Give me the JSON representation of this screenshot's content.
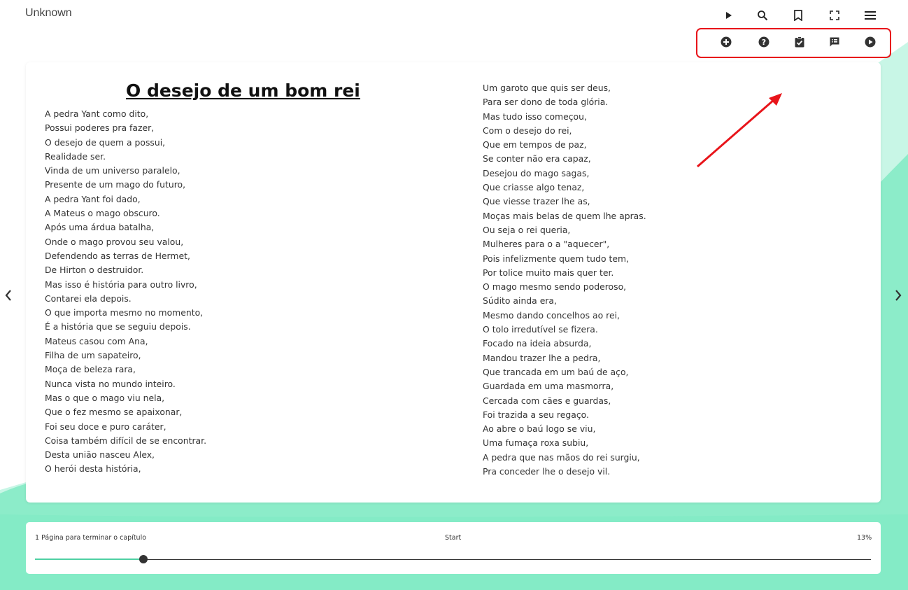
{
  "app": {
    "title": "Unknown"
  },
  "toolbar": {
    "top": [
      "play-icon",
      "search-icon",
      "bookmark-icon",
      "fullscreen-icon",
      "menu-icon"
    ],
    "secondary": [
      "add-circle-icon",
      "help-icon",
      "assignment-check-icon",
      "feedback-icon",
      "play-circle-icon"
    ]
  },
  "poem": {
    "title": "O desejo de um bom rei",
    "left_lines": [
      "A pedra Yant como dito,",
      "Possui poderes pra fazer,",
      "O desejo de quem a possui,",
      "Realidade ser.",
      "Vinda de um universo paralelo,",
      "Presente de um mago do futuro,",
      "A pedra Yant foi dado,",
      "A Mateus o mago obscuro.",
      "Após uma árdua batalha,",
      "Onde o mago provou seu valou,",
      "Defendendo as terras de Hermet,",
      "De Hirton o destruidor.",
      "Mas isso é história para outro livro,",
      "Contarei ela depois.",
      "O que importa mesmo no momento,",
      "É a história que se seguiu depois.",
      "Mateus casou com Ana,",
      "Filha de um sapateiro,",
      "Moça de beleza rara,",
      "Nunca vista no mundo inteiro.",
      "Mas o que o mago viu nela,",
      "Que o fez mesmo se apaixonar,",
      "Foi seu doce e puro caráter,",
      "Coisa também difícil de se encontrar.",
      "Desta união nasceu Alex,",
      "O herói desta história,"
    ],
    "right_lines": [
      "Um garoto que quis ser deus,",
      "Para ser dono de toda glória.",
      "Mas tudo isso começou,",
      "Com o desejo do rei,",
      "Que em tempos de paz,",
      "Se conter não era capaz,",
      "Desejou do mago sagas,",
      "Que criasse algo tenaz,",
      "Que viesse trazer lhe as,",
      "Moças mais belas de quem lhe apras.",
      "Ou seja o rei queria,",
      "Mulheres para o a \"aquecer\",",
      "Pois infelizmente quem tudo tem,",
      "Por tolice muito mais quer ter.",
      "O mago mesmo sendo poderoso,",
      "Súdito ainda era,",
      "Mesmo dando concelhos ao rei,",
      "O tolo irredutível se fizera.",
      "Focado na ideia absurda,",
      "Mandou trazer lhe a pedra,",
      "Que trancada em um baú de aço,",
      "Guardada em uma masmorra,",
      "Cercada com cães e guardas,",
      "Foi trazida a seu regaço.",
      "Ao abre o baú logo se viu,",
      "Uma fumaça roxa subiu,",
      "A pedra que nas mãos do rei surgiu,",
      "Pra conceder lhe o desejo vil."
    ]
  },
  "navigation": {
    "prev": "chevron-left-icon",
    "next": "chevron-right-icon"
  },
  "progress": {
    "pages_left_text": "1 Página para terminar o capítulo",
    "section_text": "Start",
    "percent_text": "13%",
    "fraction": 0.13
  },
  "colors": {
    "accent": "#4fd1a3",
    "highlight": "#e8141a",
    "background_green": "#7fe8c3"
  }
}
